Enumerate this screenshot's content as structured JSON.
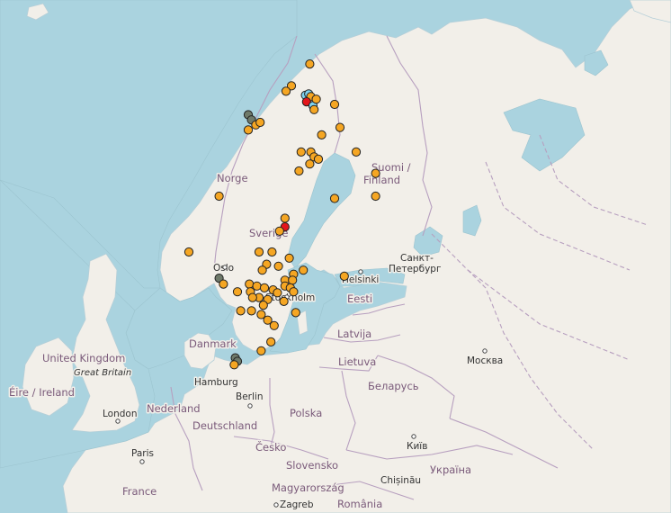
{
  "colors": {
    "water": "#aad3df",
    "land": "#f2efe9",
    "border": "#b79fbf",
    "marker_orange": "#f5a623",
    "marker_red": "#e3161b",
    "marker_cyan": "#7fd3f0",
    "marker_gray": "#6f7a6a"
  },
  "labels": {
    "norge": "Norge",
    "sverige": "Sverige",
    "suomi": "Suomi /",
    "finland": "Finland",
    "helsinki": "Helsinki",
    "spb1": "Санкт-",
    "spb2": "Петербург",
    "eesti": "Eesti",
    "stockholm": "Stockholm",
    "oslo": "Oslo",
    "danmark": "Danmark",
    "latvija": "Latvija",
    "lietuva": "Lietuva",
    "uk": "United Kingdom",
    "gb": "Great Britain",
    "eire": "Éire / Ireland",
    "london": "London",
    "nederland": "Nederland",
    "hamburg": "Hamburg",
    "berlin": "Berlin",
    "deutschland": "Deutschland",
    "polska": "Polska",
    "belarus": "Беларусь",
    "moskva": "Москва",
    "paris": "Paris",
    "france": "France",
    "cesko": "Česko",
    "slovensko": "Slovensko",
    "magyarorszag": "Magyarország",
    "zagreb": "Zagreb",
    "romania": "România",
    "chisinau": "Chișinău",
    "kyiv": "Київ",
    "ukraina": "Україна"
  },
  "markers": [
    {
      "lon": 18.5,
      "lat": 68.7,
      "type": "orange"
    },
    {
      "lon": 20.2,
      "lat": 69.5,
      "type": "orange"
    },
    {
      "lon": 18.0,
      "lat": 68.5,
      "type": "orange"
    },
    {
      "lon": 14.5,
      "lat": 67.6,
      "type": "gray"
    },
    {
      "lon": 14.8,
      "lat": 67.4,
      "type": "gray"
    },
    {
      "lon": 15.2,
      "lat": 67.2,
      "type": "orange"
    },
    {
      "lon": 15.6,
      "lat": 67.3,
      "type": "orange"
    },
    {
      "lon": 14.5,
      "lat": 67.0,
      "type": "orange"
    },
    {
      "lon": 19.8,
      "lat": 68.35,
      "type": "cyan"
    },
    {
      "lon": 20.1,
      "lat": 68.4,
      "type": "cyan"
    },
    {
      "lon": 20.3,
      "lat": 68.3,
      "type": "orange"
    },
    {
      "lon": 19.9,
      "lat": 68.1,
      "type": "red"
    },
    {
      "lon": 20.5,
      "lat": 67.95,
      "type": "cyan"
    },
    {
      "lon": 20.8,
      "lat": 68.2,
      "type": "orange"
    },
    {
      "lon": 20.6,
      "lat": 67.8,
      "type": "orange"
    },
    {
      "lon": 22.5,
      "lat": 68.0,
      "type": "orange"
    },
    {
      "lon": 23.0,
      "lat": 67.1,
      "type": "orange"
    },
    {
      "lon": 21.3,
      "lat": 66.8,
      "type": "orange"
    },
    {
      "lon": 24.5,
      "lat": 66.1,
      "type": "orange"
    },
    {
      "lon": 19.4,
      "lat": 66.1,
      "type": "orange"
    },
    {
      "lon": 20.3,
      "lat": 66.1,
      "type": "orange"
    },
    {
      "lon": 20.6,
      "lat": 65.9,
      "type": "orange"
    },
    {
      "lon": 21.0,
      "lat": 65.8,
      "type": "orange"
    },
    {
      "lon": 20.2,
      "lat": 65.6,
      "type": "orange"
    },
    {
      "lon": 19.2,
      "lat": 65.3,
      "type": "orange"
    },
    {
      "lon": 26.3,
      "lat": 65.2,
      "type": "orange"
    },
    {
      "lon": 26.3,
      "lat": 64.2,
      "type": "orange"
    },
    {
      "lon": 22.5,
      "lat": 64.1,
      "type": "orange"
    },
    {
      "lon": 11.8,
      "lat": 64.2,
      "type": "orange"
    },
    {
      "lon": 17.9,
      "lat": 63.2,
      "type": "orange"
    },
    {
      "lon": 17.9,
      "lat": 62.8,
      "type": "red"
    },
    {
      "lon": 17.4,
      "lat": 62.6,
      "type": "orange"
    },
    {
      "lon": 9.0,
      "lat": 61.6,
      "type": "orange"
    },
    {
      "lon": 11.8,
      "lat": 60.3,
      "type": "gray"
    },
    {
      "lon": 12.2,
      "lat": 60.0,
      "type": "orange"
    },
    {
      "lon": 15.5,
      "lat": 61.6,
      "type": "orange"
    },
    {
      "lon": 16.7,
      "lat": 61.6,
      "type": "orange"
    },
    {
      "lon": 18.3,
      "lat": 61.3,
      "type": "orange"
    },
    {
      "lon": 16.2,
      "lat": 61.0,
      "type": "orange"
    },
    {
      "lon": 17.3,
      "lat": 60.9,
      "type": "orange"
    },
    {
      "lon": 15.8,
      "lat": 60.7,
      "type": "orange"
    },
    {
      "lon": 19.6,
      "lat": 60.7,
      "type": "orange"
    },
    {
      "lon": 18.7,
      "lat": 60.5,
      "type": "orange"
    },
    {
      "lon": 23.4,
      "lat": 60.4,
      "type": "orange"
    },
    {
      "lon": 17.9,
      "lat": 60.2,
      "type": "orange"
    },
    {
      "lon": 18.6,
      "lat": 60.2,
      "type": "orange"
    },
    {
      "lon": 14.6,
      "lat": 60.0,
      "type": "orange"
    },
    {
      "lon": 15.3,
      "lat": 59.9,
      "type": "orange"
    },
    {
      "lon": 16.0,
      "lat": 59.8,
      "type": "orange"
    },
    {
      "lon": 17.9,
      "lat": 59.9,
      "type": "orange"
    },
    {
      "lon": 18.4,
      "lat": 59.8,
      "type": "orange"
    },
    {
      "lon": 13.5,
      "lat": 59.6,
      "type": "orange"
    },
    {
      "lon": 14.7,
      "lat": 59.6,
      "type": "orange"
    },
    {
      "lon": 16.8,
      "lat": 59.7,
      "type": "orange"
    },
    {
      "lon": 17.2,
      "lat": 59.55,
      "type": "orange"
    },
    {
      "lon": 18.7,
      "lat": 59.6,
      "type": "orange"
    },
    {
      "lon": 15.5,
      "lat": 59.3,
      "type": "orange"
    },
    {
      "lon": 14.9,
      "lat": 59.3,
      "type": "orange"
    },
    {
      "lon": 16.3,
      "lat": 59.2,
      "type": "orange"
    },
    {
      "lon": 17.8,
      "lat": 59.1,
      "type": "orange"
    },
    {
      "lon": 15.9,
      "lat": 58.9,
      "type": "orange"
    },
    {
      "lon": 13.8,
      "lat": 58.6,
      "type": "orange"
    },
    {
      "lon": 14.8,
      "lat": 58.6,
      "type": "orange"
    },
    {
      "lon": 15.7,
      "lat": 58.4,
      "type": "orange"
    },
    {
      "lon": 18.9,
      "lat": 58.5,
      "type": "orange"
    },
    {
      "lon": 16.3,
      "lat": 58.1,
      "type": "orange"
    },
    {
      "lon": 16.9,
      "lat": 57.8,
      "type": "orange"
    },
    {
      "lon": 16.6,
      "lat": 56.9,
      "type": "orange"
    },
    {
      "lon": 15.7,
      "lat": 56.4,
      "type": "orange"
    },
    {
      "lon": 13.3,
      "lat": 56.0,
      "type": "gray"
    },
    {
      "lon": 13.5,
      "lat": 55.8,
      "type": "gray"
    },
    {
      "lon": 13.2,
      "lat": 55.6,
      "type": "orange"
    }
  ]
}
